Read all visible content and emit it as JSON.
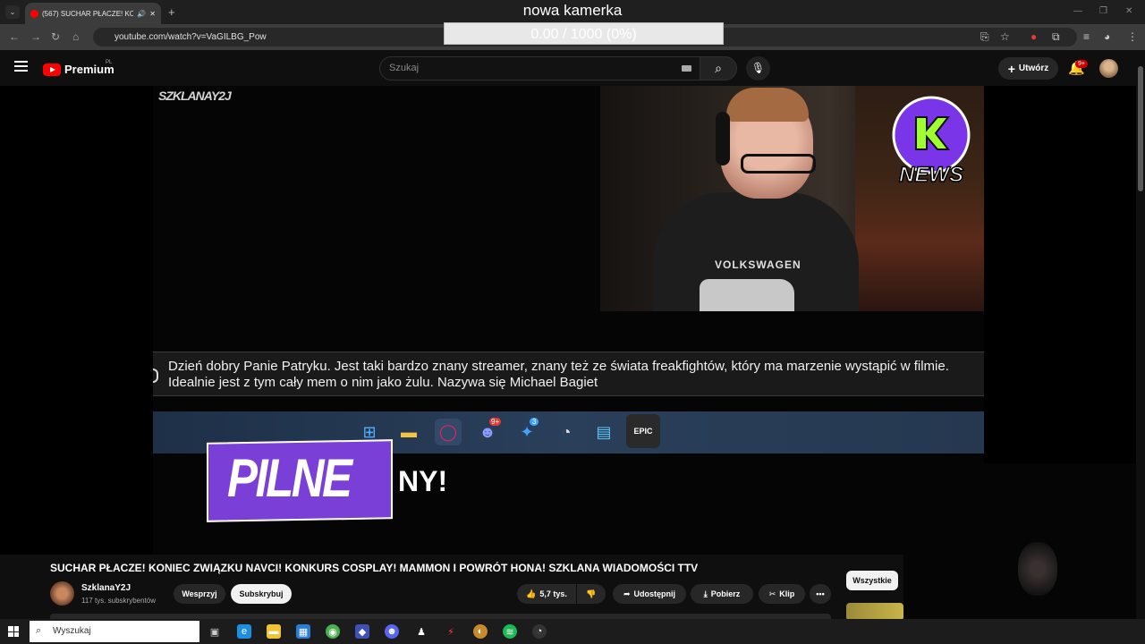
{
  "browser": {
    "tab_title": "(567) SUCHAR PŁACZE! KONIEC",
    "new_tab": "+",
    "tab_dropdown": "⌄",
    "url": "youtube.com/watch?v=VaGILBG_Pow",
    "window_controls": [
      "—",
      "❐",
      "✕"
    ]
  },
  "overlay": {
    "title": "nowa kamerka",
    "progress_text": "0.00 / 1000 (0%)",
    "progress_fraction": 0
  },
  "youtube": {
    "logo_text": "Premium",
    "logo_region": "PL",
    "search_placeholder": "Szukaj",
    "create_label": "Utwórz",
    "notif_badge": "9+"
  },
  "video": {
    "watermark": "SZKLANAY2J",
    "subtitle": "Dzień dobry Panie Patryku. Jest taki bardzo znany streamer, znany też ze świata freakfightów, który ma marzenie wystąpić w filmie. Idealnie jest z tym cały mem o nim jako żulu. Nazywa się Michael Bagiet",
    "shirt_text": "VOLKSWAGEN",
    "news_logo": "NEWS",
    "pilne": "PILNE",
    "pilne_tail": "NY!",
    "taskbar_icons": [
      "windows-icon",
      "folder-icon",
      "opera-icon",
      "discord-icon",
      "messenger-icon",
      "obs-icon",
      "notepad-icon",
      "epic-games-icon"
    ],
    "discord_badge": "9+",
    "messenger_badge": "3",
    "epic_label": "EPIC"
  },
  "watch": {
    "title": "SUCHAR PŁACZE! KONIEC ZWIĄZKU NAVCI! KONKURS COSPLAY! MAMMON I POWRÓT HONA! SZKLANA WIADOMOŚCI TTV",
    "channel": "SzklanaY2J",
    "subs": "117 tys. subskrybentów",
    "join": "Wesprzyj",
    "subscribe": "Subskrybuj",
    "likes": "5,7 tys.",
    "share": "Udostępnij",
    "download": "Pobierz",
    "clip": "Klip",
    "more": "•••",
    "chip_all": "Wszystkie"
  },
  "windows": {
    "search_placeholder": "Wyszukaj"
  }
}
